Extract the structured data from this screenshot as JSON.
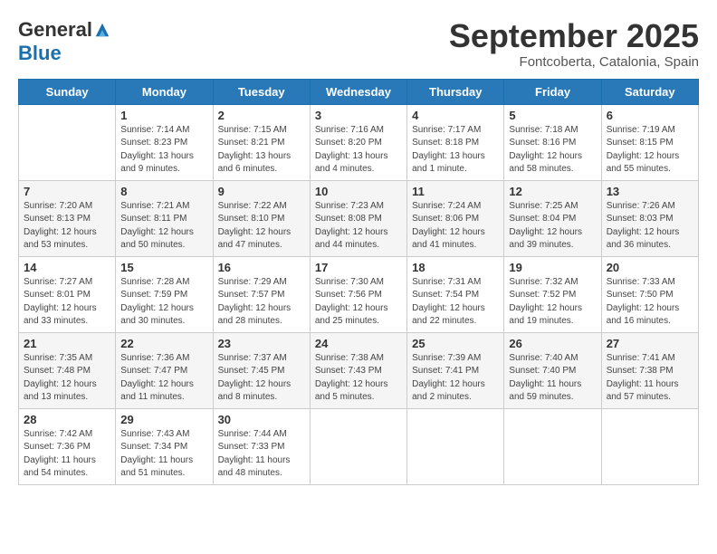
{
  "logo": {
    "general": "General",
    "blue": "Blue"
  },
  "header": {
    "month": "September 2025",
    "location": "Fontcoberta, Catalonia, Spain"
  },
  "days_of_week": [
    "Sunday",
    "Monday",
    "Tuesday",
    "Wednesday",
    "Thursday",
    "Friday",
    "Saturday"
  ],
  "weeks": [
    [
      {
        "day": "",
        "sunrise": "",
        "sunset": "",
        "daylight": ""
      },
      {
        "day": "1",
        "sunrise": "Sunrise: 7:14 AM",
        "sunset": "Sunset: 8:23 PM",
        "daylight": "Daylight: 13 hours and 9 minutes."
      },
      {
        "day": "2",
        "sunrise": "Sunrise: 7:15 AM",
        "sunset": "Sunset: 8:21 PM",
        "daylight": "Daylight: 13 hours and 6 minutes."
      },
      {
        "day": "3",
        "sunrise": "Sunrise: 7:16 AM",
        "sunset": "Sunset: 8:20 PM",
        "daylight": "Daylight: 13 hours and 4 minutes."
      },
      {
        "day": "4",
        "sunrise": "Sunrise: 7:17 AM",
        "sunset": "Sunset: 8:18 PM",
        "daylight": "Daylight: 13 hours and 1 minute."
      },
      {
        "day": "5",
        "sunrise": "Sunrise: 7:18 AM",
        "sunset": "Sunset: 8:16 PM",
        "daylight": "Daylight: 12 hours and 58 minutes."
      },
      {
        "day": "6",
        "sunrise": "Sunrise: 7:19 AM",
        "sunset": "Sunset: 8:15 PM",
        "daylight": "Daylight: 12 hours and 55 minutes."
      }
    ],
    [
      {
        "day": "7",
        "sunrise": "Sunrise: 7:20 AM",
        "sunset": "Sunset: 8:13 PM",
        "daylight": "Daylight: 12 hours and 53 minutes."
      },
      {
        "day": "8",
        "sunrise": "Sunrise: 7:21 AM",
        "sunset": "Sunset: 8:11 PM",
        "daylight": "Daylight: 12 hours and 50 minutes."
      },
      {
        "day": "9",
        "sunrise": "Sunrise: 7:22 AM",
        "sunset": "Sunset: 8:10 PM",
        "daylight": "Daylight: 12 hours and 47 minutes."
      },
      {
        "day": "10",
        "sunrise": "Sunrise: 7:23 AM",
        "sunset": "Sunset: 8:08 PM",
        "daylight": "Daylight: 12 hours and 44 minutes."
      },
      {
        "day": "11",
        "sunrise": "Sunrise: 7:24 AM",
        "sunset": "Sunset: 8:06 PM",
        "daylight": "Daylight: 12 hours and 41 minutes."
      },
      {
        "day": "12",
        "sunrise": "Sunrise: 7:25 AM",
        "sunset": "Sunset: 8:04 PM",
        "daylight": "Daylight: 12 hours and 39 minutes."
      },
      {
        "day": "13",
        "sunrise": "Sunrise: 7:26 AM",
        "sunset": "Sunset: 8:03 PM",
        "daylight": "Daylight: 12 hours and 36 minutes."
      }
    ],
    [
      {
        "day": "14",
        "sunrise": "Sunrise: 7:27 AM",
        "sunset": "Sunset: 8:01 PM",
        "daylight": "Daylight: 12 hours and 33 minutes."
      },
      {
        "day": "15",
        "sunrise": "Sunrise: 7:28 AM",
        "sunset": "Sunset: 7:59 PM",
        "daylight": "Daylight: 12 hours and 30 minutes."
      },
      {
        "day": "16",
        "sunrise": "Sunrise: 7:29 AM",
        "sunset": "Sunset: 7:57 PM",
        "daylight": "Daylight: 12 hours and 28 minutes."
      },
      {
        "day": "17",
        "sunrise": "Sunrise: 7:30 AM",
        "sunset": "Sunset: 7:56 PM",
        "daylight": "Daylight: 12 hours and 25 minutes."
      },
      {
        "day": "18",
        "sunrise": "Sunrise: 7:31 AM",
        "sunset": "Sunset: 7:54 PM",
        "daylight": "Daylight: 12 hours and 22 minutes."
      },
      {
        "day": "19",
        "sunrise": "Sunrise: 7:32 AM",
        "sunset": "Sunset: 7:52 PM",
        "daylight": "Daylight: 12 hours and 19 minutes."
      },
      {
        "day": "20",
        "sunrise": "Sunrise: 7:33 AM",
        "sunset": "Sunset: 7:50 PM",
        "daylight": "Daylight: 12 hours and 16 minutes."
      }
    ],
    [
      {
        "day": "21",
        "sunrise": "Sunrise: 7:35 AM",
        "sunset": "Sunset: 7:48 PM",
        "daylight": "Daylight: 12 hours and 13 minutes."
      },
      {
        "day": "22",
        "sunrise": "Sunrise: 7:36 AM",
        "sunset": "Sunset: 7:47 PM",
        "daylight": "Daylight: 12 hours and 11 minutes."
      },
      {
        "day": "23",
        "sunrise": "Sunrise: 7:37 AM",
        "sunset": "Sunset: 7:45 PM",
        "daylight": "Daylight: 12 hours and 8 minutes."
      },
      {
        "day": "24",
        "sunrise": "Sunrise: 7:38 AM",
        "sunset": "Sunset: 7:43 PM",
        "daylight": "Daylight: 12 hours and 5 minutes."
      },
      {
        "day": "25",
        "sunrise": "Sunrise: 7:39 AM",
        "sunset": "Sunset: 7:41 PM",
        "daylight": "Daylight: 12 hours and 2 minutes."
      },
      {
        "day": "26",
        "sunrise": "Sunrise: 7:40 AM",
        "sunset": "Sunset: 7:40 PM",
        "daylight": "Daylight: 11 hours and 59 minutes."
      },
      {
        "day": "27",
        "sunrise": "Sunrise: 7:41 AM",
        "sunset": "Sunset: 7:38 PM",
        "daylight": "Daylight: 11 hours and 57 minutes."
      }
    ],
    [
      {
        "day": "28",
        "sunrise": "Sunrise: 7:42 AM",
        "sunset": "Sunset: 7:36 PM",
        "daylight": "Daylight: 11 hours and 54 minutes."
      },
      {
        "day": "29",
        "sunrise": "Sunrise: 7:43 AM",
        "sunset": "Sunset: 7:34 PM",
        "daylight": "Daylight: 11 hours and 51 minutes."
      },
      {
        "day": "30",
        "sunrise": "Sunrise: 7:44 AM",
        "sunset": "Sunset: 7:33 PM",
        "daylight": "Daylight: 11 hours and 48 minutes."
      },
      {
        "day": "",
        "sunrise": "",
        "sunset": "",
        "daylight": ""
      },
      {
        "day": "",
        "sunrise": "",
        "sunset": "",
        "daylight": ""
      },
      {
        "day": "",
        "sunrise": "",
        "sunset": "",
        "daylight": ""
      },
      {
        "day": "",
        "sunrise": "",
        "sunset": "",
        "daylight": ""
      }
    ]
  ]
}
